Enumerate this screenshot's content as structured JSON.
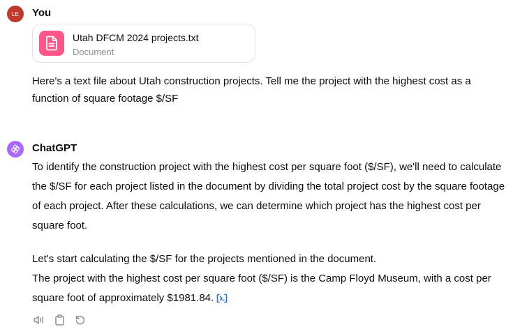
{
  "user_turn": {
    "avatar_initials": "LE",
    "author": "You",
    "attachment": {
      "name": "Utah DFCM 2024 projects.txt",
      "type": "Document",
      "icon": "document-icon",
      "icon_color": "#ff5588"
    },
    "message": "Here's a text file about Utah construction projects.  Tell me the project with the highest cost as a function of square footage $/SF"
  },
  "assistant_turn": {
    "author": "ChatGPT",
    "avatar_color": "#ab68ff",
    "paragraphs": [
      "To identify the construction project with the highest cost per square foot ($/SF), we'll need to calculate the $/SF for each project listed in the document by dividing the total project cost by the square footage of each project. After these calculations, we can determine which project has the highest cost per square foot.",
      "Let's start calculating the $/SF for the projects mentioned in the document.",
      "The project with the highest cost per square foot ($/SF) is the Camp Floyd Museum, with a cost per square foot of approximately $1981.84."
    ],
    "source_icon": "code-interpreter-icon",
    "actions": [
      {
        "name": "read-aloud-icon"
      },
      {
        "name": "copy-icon"
      },
      {
        "name": "regenerate-icon"
      }
    ]
  },
  "colors": {
    "text": "#0d0d0d",
    "muted": "#8e8e8e",
    "user_avatar": "#c0392b",
    "link": "#2f6fd6"
  }
}
